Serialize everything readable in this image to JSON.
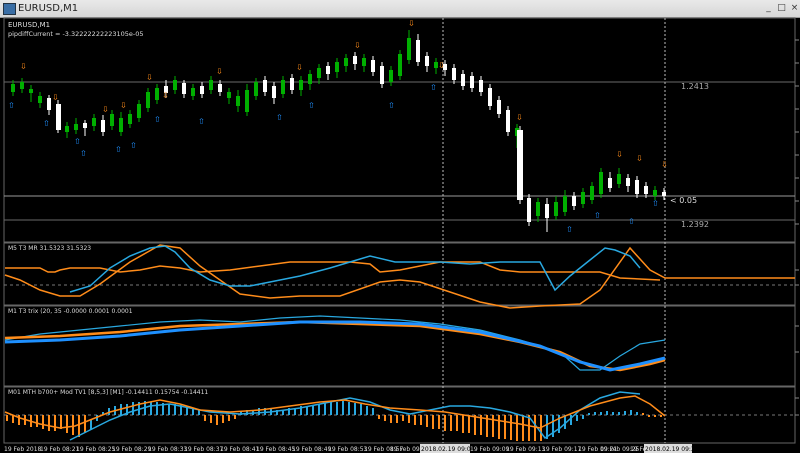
{
  "window": {
    "title": "EURUSD,M1",
    "buttons": [
      "_",
      "□",
      "×"
    ]
  },
  "main_panel": {
    "symbol_label": "EURUSD,M1",
    "indicator_text": "pipdiffCurrent = -3.32222222223105e-05",
    "level_high": "1.2413",
    "level_low": "1.2392",
    "current_marker": "< 0.05"
  },
  "sub_panels": [
    {
      "label": "M5  T3 MR  31.5323 31.5323"
    },
    {
      "label": "M1 T3 trix (20, 35 -0.0000 0.0001 0.0001"
    },
    {
      "label": "M01 MTH b700+ Mod TV1 [8,5,3] [M1] -0.14411 0.15754 -0.14411"
    }
  ],
  "time_axis": {
    "labels": [
      "19 Feb 2018",
      "19 Feb 08:21",
      "19 Feb 08:25",
      "19 Feb 08:29",
      "19 Feb 08:33",
      "19 Feb 08:37",
      "19 Feb 08:41",
      "19 Feb 08:45",
      "19 Feb 08:49",
      "19 Feb 08:53",
      "19 Feb 08:57",
      "19 Feb 09:01",
      "2018.02.19 09:08",
      "19 Feb 09:09",
      "19 Feb 09:13",
      "19 Feb 09:17",
      "19 Feb 09:21",
      "19 Feb 09:25",
      "19 Feb 09:",
      "2018.02.19 09:34"
    ]
  },
  "colors": {
    "bull": "#00b000",
    "bear": "#ffffff",
    "orange": "#ff8c1a",
    "blue": "#1e90ff",
    "grid": "#505050"
  }
}
